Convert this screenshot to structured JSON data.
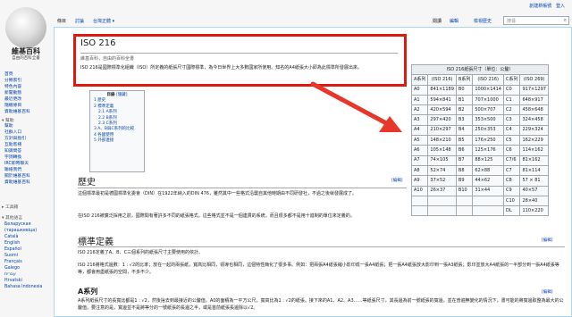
{
  "logo": {
    "title": "維基百科",
    "subtitle": "自由的百科全書"
  },
  "top_links": [
    "創建新帳號",
    "登入"
  ],
  "sidebar": {
    "main": [
      "首頁",
      "分類索引",
      "特色內容",
      "新聞動態",
      "最近更改",
      "隨機條目",
      "資助維基百科"
    ],
    "help_head": "幫助",
    "help": [
      "幫助",
      "社群入口",
      "方針與指引",
      "互助客棧",
      "知識問答",
      "字詞轉換",
      "IRC即時聊天",
      "聯絡我們",
      "關於維基百科",
      "資助維基百科"
    ],
    "tools_head": "工具箱",
    "lang_head": "其他語言",
    "langs": [
      "Беларуская",
      "(тарашкевіца)",
      "Català",
      "English",
      "Español",
      "Suomi",
      "Français",
      "Galego",
      "עברית",
      "Hrvatski",
      "Bahasa Indonesia"
    ]
  },
  "tabs": {
    "page": "條目",
    "discussion": "討論",
    "variant": "台灣正體",
    "read": "閱讀",
    "edit": "編輯",
    "history": "檢視歷史",
    "search_placeholder": "搜尋"
  },
  "highlight": {
    "title": "ISO 216",
    "from": "維基百科，自由的百科全書",
    "lead": "ISO 216是國際標準化組織（ISO）所定義的紙張尺寸國際標準，為今日世界上大多數國家所使用。知名的A4紙張大小即為此標準所發展出來。"
  },
  "toc": {
    "title": "目錄",
    "hide": "[隱藏]",
    "items": [
      "1 歷史",
      "2 標準定義",
      "2.1 A系列",
      "2.2 B系列",
      "2.3 C系列",
      "3 A、B與C系列的比較",
      "4 各國使用",
      "5 外部連接"
    ]
  },
  "sections": {
    "history": {
      "title": "歷史",
      "edit": "[編輯]",
      "p1": "這個標準最初是德國標準化委會（DIN）在1922年納入的DIN 476，雖然其中一些格式沿襲自其他時期由不同研發社，不過之後就發展成了。",
      "p2": "在ISO 216被廣泛採用之前，國際間有著許多不同的紙張格式。這些格式並不是一個連貫的系統，而且很多都不是用十進制的單位來定義的。"
    },
    "definition": {
      "title": "標準定義",
      "edit": "[編輯]",
      "p1": "ISO 216定義了A、B、C三個系列的紙張尺寸主要使用的依計。",
      "p2": "ISO 216將格式邊數：1 : √2的比率；放在一起的兩張紙，寬高比相同，領導也相同，這個特性簡化了很多事。例如：把兩張A4紙張縮小影印成一張A4紙張；把一張A4紙張放大影印到一張A3紙張；影印並放大A4紙張的一半部分到一張A4紙張等等，都會用盡紙張的空間，不多不少。"
    },
    "aseries": {
      "title": "A系列",
      "edit": "[編輯]",
      "p1": "A系列紙張尺寸的長寬比都是1 : √2，然後捨去到最接近的公釐值。A0的面積為一平方公尺，寬高比為1 : √2的紙張。接下來的A1、A2、A3……等紙張尺寸，其長邊為前一號紙張的寬邊，並在普遍無變化的情況下，書可能的將寬邊取整為最大的公釐值。要注意的是，寬邊並不是將等分的一號紙張的長邊之半，或是首前紙張長邊除以√2。"
    }
  },
  "paper_table": {
    "caption": "ISO 216紙張尺寸（單位：公釐）",
    "headers": [
      "A系列",
      "(ISO 216)",
      "B系列",
      "(ISO 216)",
      "C系列",
      "(ISO 269)"
    ],
    "rows": [
      [
        "A0",
        "841×1189",
        "B0",
        "1000×1414",
        "C0",
        "917×1297"
      ],
      [
        "A1",
        "594×841",
        "B1",
        "707×1000",
        "C1",
        "648×917"
      ],
      [
        "A2",
        "420×594",
        "B2",
        "500×707",
        "C2",
        "458×648"
      ],
      [
        "A3",
        "297×420",
        "B3",
        "353×500",
        "C3",
        "324×458"
      ],
      [
        "A4",
        "210×297",
        "B4",
        "250×353",
        "C4",
        "229×324"
      ],
      [
        "A5",
        "148×210",
        "B5",
        "176×250",
        "C5",
        "162×229"
      ],
      [
        "A6",
        "105×148",
        "B6",
        "125×176",
        "C6",
        "114×162"
      ],
      [
        "A7",
        "74×105",
        "B7",
        "88×125",
        "C7/6",
        "81×162"
      ],
      [
        "A8",
        "52×74",
        "B8",
        "62×88",
        "C7",
        "81×114"
      ],
      [
        "A9",
        "37×52",
        "B9",
        "44×62",
        "C8",
        "57 × 81"
      ],
      [
        "A10",
        "26×37",
        "B10",
        "31×44",
        "C9",
        "40×57"
      ],
      [
        "",
        "",
        "",
        "",
        "C10",
        "28×40"
      ],
      [
        "",
        "",
        "",
        "",
        "DL",
        "110×220"
      ]
    ]
  },
  "colors": {
    "highlight_border": "#e0190f",
    "arrow": "#e8372a",
    "link": "#0645ad"
  }
}
